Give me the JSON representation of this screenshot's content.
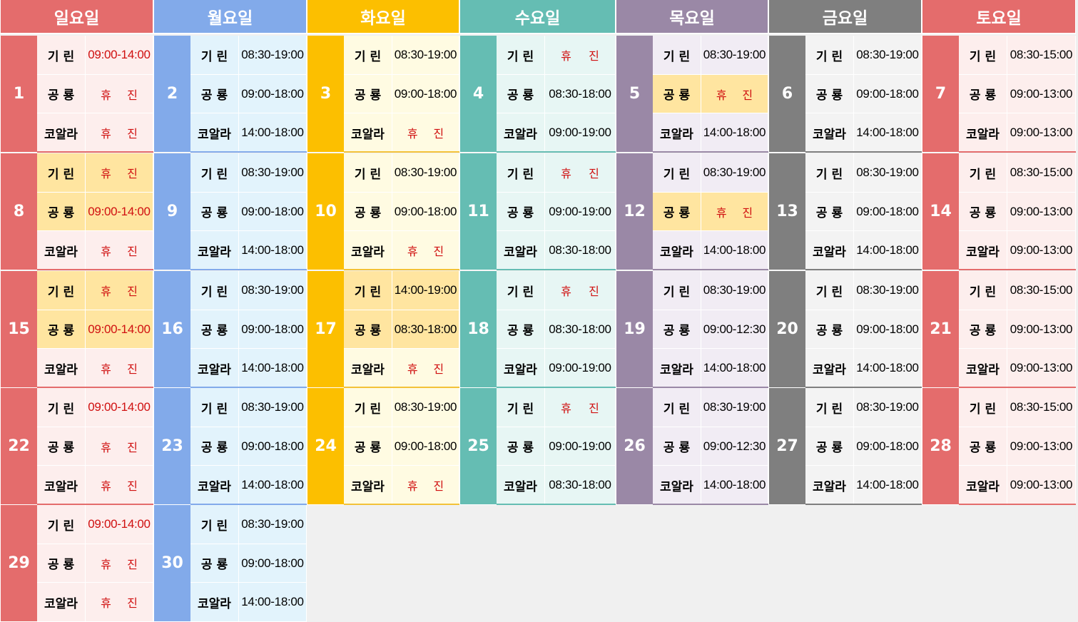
{
  "weekdays": [
    {
      "label": "일요일",
      "head": "#e46c6c",
      "num": "#e46c6c",
      "cell": "#fdeeed",
      "line": "#e46c6c"
    },
    {
      "label": "월요일",
      "head": "#82aaea",
      "num": "#82aaea",
      "cell": "#e2f3fc",
      "line": "#82aaea"
    },
    {
      "label": "화요일",
      "head": "#fcbf00",
      "num": "#fcbf00",
      "cell": "#fffbe2",
      "line": "#f3c238"
    },
    {
      "label": "수요일",
      "head": "#65bdb3",
      "num": "#65bdb3",
      "cell": "#e7f6f4",
      "line": "#65bdb3"
    },
    {
      "label": "목요일",
      "head": "#9a88a6",
      "num": "#9a88a6",
      "cell": "#f1ecf4",
      "line": "#9a88a6"
    },
    {
      "label": "금요일",
      "head": "#7f7f7f",
      "num": "#7f7f7f",
      "cell": "#f3f3f3",
      "line": "#7f7f7f"
    },
    {
      "label": "토요일",
      "head": "#e46c6c",
      "num": "#e46c6c",
      "cell": "#fdeeed",
      "line": "#e46c6c"
    }
  ],
  "highlight_color": "#ffe5a0",
  "closed_text": [
    "휴",
    "진"
  ],
  "rows": [
    "기 린",
    "공 룡",
    "코알라"
  ],
  "days": [
    {
      "day": "1",
      "col": 0,
      "week": 0,
      "times": [
        "09:00-14:00",
        null,
        null
      ],
      "red": [
        true,
        false,
        false
      ],
      "hl": [
        false,
        false,
        false
      ]
    },
    {
      "day": "2",
      "col": 1,
      "week": 0,
      "times": [
        "08:30-19:00",
        "09:00-18:00",
        "14:00-18:00"
      ],
      "red": [
        false,
        false,
        false
      ],
      "hl": [
        false,
        false,
        false
      ]
    },
    {
      "day": "3",
      "col": 2,
      "week": 0,
      "times": [
        "08:30-19:00",
        "09:00-18:00",
        null
      ],
      "red": [
        false,
        false,
        false
      ],
      "hl": [
        false,
        false,
        false
      ]
    },
    {
      "day": "4",
      "col": 3,
      "week": 0,
      "times": [
        null,
        "08:30-18:00",
        "09:00-19:00"
      ],
      "red": [
        false,
        false,
        false
      ],
      "hl": [
        false,
        false,
        false
      ]
    },
    {
      "day": "5",
      "col": 4,
      "week": 0,
      "times": [
        "08:30-19:00",
        null,
        "14:00-18:00"
      ],
      "red": [
        false,
        false,
        false
      ],
      "hl": [
        false,
        true,
        false
      ]
    },
    {
      "day": "6",
      "col": 5,
      "week": 0,
      "times": [
        "08:30-19:00",
        "09:00-18:00",
        "14:00-18:00"
      ],
      "red": [
        false,
        false,
        false
      ],
      "hl": [
        false,
        false,
        false
      ]
    },
    {
      "day": "7",
      "col": 6,
      "week": 0,
      "times": [
        "08:30-15:00",
        "09:00-13:00",
        "09:00-13:00"
      ],
      "red": [
        false,
        false,
        false
      ],
      "hl": [
        false,
        false,
        false
      ]
    },
    {
      "day": "8",
      "col": 0,
      "week": 1,
      "times": [
        null,
        "09:00-14:00",
        null
      ],
      "red": [
        false,
        true,
        false
      ],
      "hl": [
        true,
        true,
        false
      ]
    },
    {
      "day": "9",
      "col": 1,
      "week": 1,
      "times": [
        "08:30-19:00",
        "09:00-18:00",
        "14:00-18:00"
      ],
      "red": [
        false,
        false,
        false
      ],
      "hl": [
        false,
        false,
        false
      ]
    },
    {
      "day": "10",
      "col": 2,
      "week": 1,
      "times": [
        "08:30-19:00",
        "09:00-18:00",
        null
      ],
      "red": [
        false,
        false,
        false
      ],
      "hl": [
        false,
        false,
        false
      ]
    },
    {
      "day": "11",
      "col": 3,
      "week": 1,
      "times": [
        null,
        "09:00-19:00",
        "08:30-18:00"
      ],
      "red": [
        false,
        false,
        false
      ],
      "hl": [
        false,
        false,
        false
      ]
    },
    {
      "day": "12",
      "col": 4,
      "week": 1,
      "times": [
        "08:30-19:00",
        null,
        "14:00-18:00"
      ],
      "red": [
        false,
        false,
        false
      ],
      "hl": [
        false,
        true,
        false
      ]
    },
    {
      "day": "13",
      "col": 5,
      "week": 1,
      "times": [
        "08:30-19:00",
        "09:00-18:00",
        "14:00-18:00"
      ],
      "red": [
        false,
        false,
        false
      ],
      "hl": [
        false,
        false,
        false
      ]
    },
    {
      "day": "14",
      "col": 6,
      "week": 1,
      "times": [
        "08:30-15:00",
        "09:00-13:00",
        "09:00-13:00"
      ],
      "red": [
        false,
        false,
        false
      ],
      "hl": [
        false,
        false,
        false
      ]
    },
    {
      "day": "15",
      "col": 0,
      "week": 2,
      "times": [
        null,
        "09:00-14:00",
        null
      ],
      "red": [
        false,
        true,
        false
      ],
      "hl": [
        true,
        true,
        false
      ]
    },
    {
      "day": "16",
      "col": 1,
      "week": 2,
      "times": [
        "08:30-19:00",
        "09:00-18:00",
        "14:00-18:00"
      ],
      "red": [
        false,
        false,
        false
      ],
      "hl": [
        false,
        false,
        false
      ]
    },
    {
      "day": "17",
      "col": 2,
      "week": 2,
      "times": [
        "14:00-19:00",
        "08:30-18:00",
        null
      ],
      "red": [
        false,
        false,
        false
      ],
      "hl": [
        true,
        true,
        false
      ]
    },
    {
      "day": "18",
      "col": 3,
      "week": 2,
      "times": [
        null,
        "08:30-18:00",
        "09:00-19:00"
      ],
      "red": [
        false,
        false,
        false
      ],
      "hl": [
        false,
        false,
        false
      ]
    },
    {
      "day": "19",
      "col": 4,
      "week": 2,
      "times": [
        "08:30-19:00",
        "09:00-12:30",
        "14:00-18:00"
      ],
      "red": [
        false,
        false,
        false
      ],
      "hl": [
        false,
        false,
        false
      ]
    },
    {
      "day": "20",
      "col": 5,
      "week": 2,
      "times": [
        "08:30-19:00",
        "09:00-18:00",
        "14:00-18:00"
      ],
      "red": [
        false,
        false,
        false
      ],
      "hl": [
        false,
        false,
        false
      ]
    },
    {
      "day": "21",
      "col": 6,
      "week": 2,
      "times": [
        "08:30-15:00",
        "09:00-13:00",
        "09:00-13:00"
      ],
      "red": [
        false,
        false,
        false
      ],
      "hl": [
        false,
        false,
        false
      ]
    },
    {
      "day": "22",
      "col": 0,
      "week": 3,
      "times": [
        "09:00-14:00",
        null,
        null
      ],
      "red": [
        true,
        false,
        false
      ],
      "hl": [
        false,
        false,
        false
      ]
    },
    {
      "day": "23",
      "col": 1,
      "week": 3,
      "times": [
        "08:30-19:00",
        "09:00-18:00",
        "14:00-18:00"
      ],
      "red": [
        false,
        false,
        false
      ],
      "hl": [
        false,
        false,
        false
      ]
    },
    {
      "day": "24",
      "col": 2,
      "week": 3,
      "times": [
        "08:30-19:00",
        "09:00-18:00",
        null
      ],
      "red": [
        false,
        false,
        false
      ],
      "hl": [
        false,
        false,
        false
      ]
    },
    {
      "day": "25",
      "col": 3,
      "week": 3,
      "times": [
        null,
        "09:00-19:00",
        "08:30-18:00"
      ],
      "red": [
        false,
        false,
        false
      ],
      "hl": [
        false,
        false,
        false
      ]
    },
    {
      "day": "26",
      "col": 4,
      "week": 3,
      "times": [
        "08:30-19:00",
        "09:00-12:30",
        "14:00-18:00"
      ],
      "red": [
        false,
        false,
        false
      ],
      "hl": [
        false,
        false,
        false
      ]
    },
    {
      "day": "27",
      "col": 5,
      "week": 3,
      "times": [
        "08:30-19:00",
        "09:00-18:00",
        "14:00-18:00"
      ],
      "red": [
        false,
        false,
        false
      ],
      "hl": [
        false,
        false,
        false
      ]
    },
    {
      "day": "28",
      "col": 6,
      "week": 3,
      "times": [
        "08:30-15:00",
        "09:00-13:00",
        "09:00-13:00"
      ],
      "red": [
        false,
        false,
        false
      ],
      "hl": [
        false,
        false,
        false
      ]
    },
    {
      "day": "29",
      "col": 0,
      "week": 4,
      "times": [
        "09:00-14:00",
        null,
        null
      ],
      "red": [
        true,
        false,
        false
      ],
      "hl": [
        false,
        false,
        false
      ]
    },
    {
      "day": "30",
      "col": 1,
      "week": 4,
      "times": [
        "08:30-19:00",
        "09:00-18:00",
        "14:00-18:00"
      ],
      "red": [
        false,
        false,
        false
      ],
      "hl": [
        false,
        false,
        false
      ]
    }
  ]
}
